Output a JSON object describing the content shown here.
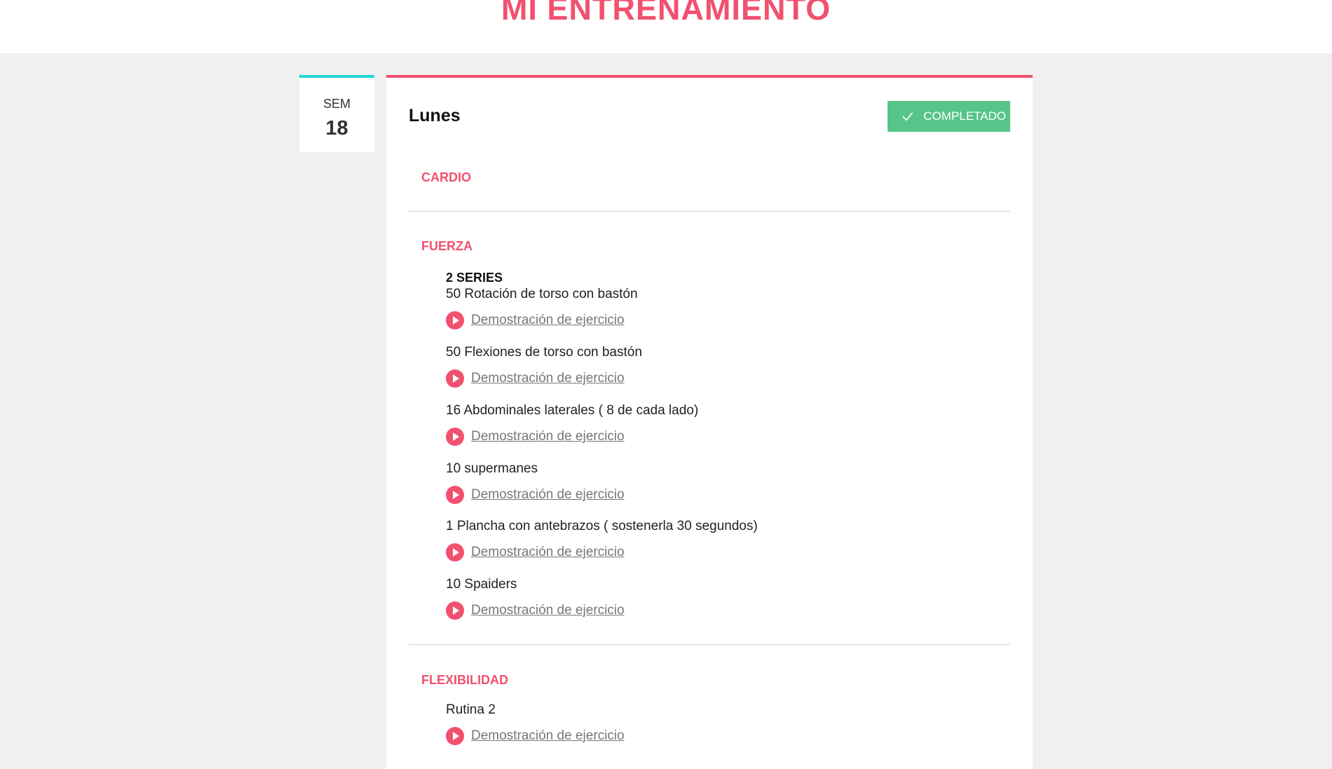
{
  "header": {
    "title": "MI ENTRENAMIENTO"
  },
  "week": {
    "label": "SEM",
    "number": "18"
  },
  "day": {
    "title": "Lunes",
    "status_label": "COMPLETADO"
  },
  "sections": [
    {
      "label": "CARDIO",
      "series": "",
      "exercises": []
    },
    {
      "label": "FUERZA",
      "series": "2 SERIES",
      "exercises": [
        {
          "name": "50 Rotación de torso con bastón",
          "link": "Demostración de ejercicio"
        },
        {
          "name": "50 Flexiones de torso con bastón",
          "link": "Demostración de ejercicio"
        },
        {
          "name": "16 Abdominales laterales ( 8 de cada lado)",
          "link": "Demostración de ejercicio"
        },
        {
          "name": "10 supermanes",
          "link": "Demostración de ejercicio"
        },
        {
          "name": "1 Plancha con antebrazos ( sostenerla 30 segundos)",
          "link": "Demostración de ejercicio"
        },
        {
          "name": "10 Spaiders",
          "link": "Demostración de ejercicio"
        }
      ]
    },
    {
      "label": "FLEXIBILIDAD",
      "series": "",
      "exercises": [
        {
          "name": "Rutina 2",
          "link": "Demostración de ejercicio"
        }
      ]
    }
  ],
  "colors": {
    "accent": "#f2506f",
    "week_border": "#22d4d8",
    "completed": "#57c48a"
  }
}
